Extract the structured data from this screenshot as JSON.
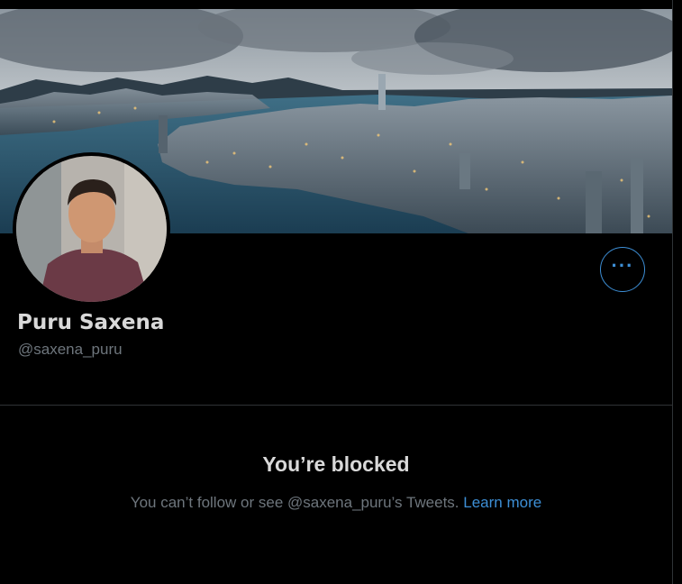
{
  "profile": {
    "display_name": "Puru Saxena",
    "handle": "@saxena_puru",
    "more_icon": "more-horizontal-icon"
  },
  "blocked": {
    "title": "You’re blocked",
    "message": "You can’t follow or see @saxena_puru’s Tweets.",
    "learn_more": "Learn more"
  },
  "colors": {
    "background": "#000000",
    "text_primary": "#d9d9d9",
    "text_secondary": "#6e767d",
    "accent": "#3d8fd6",
    "divider": "#2f3336"
  }
}
